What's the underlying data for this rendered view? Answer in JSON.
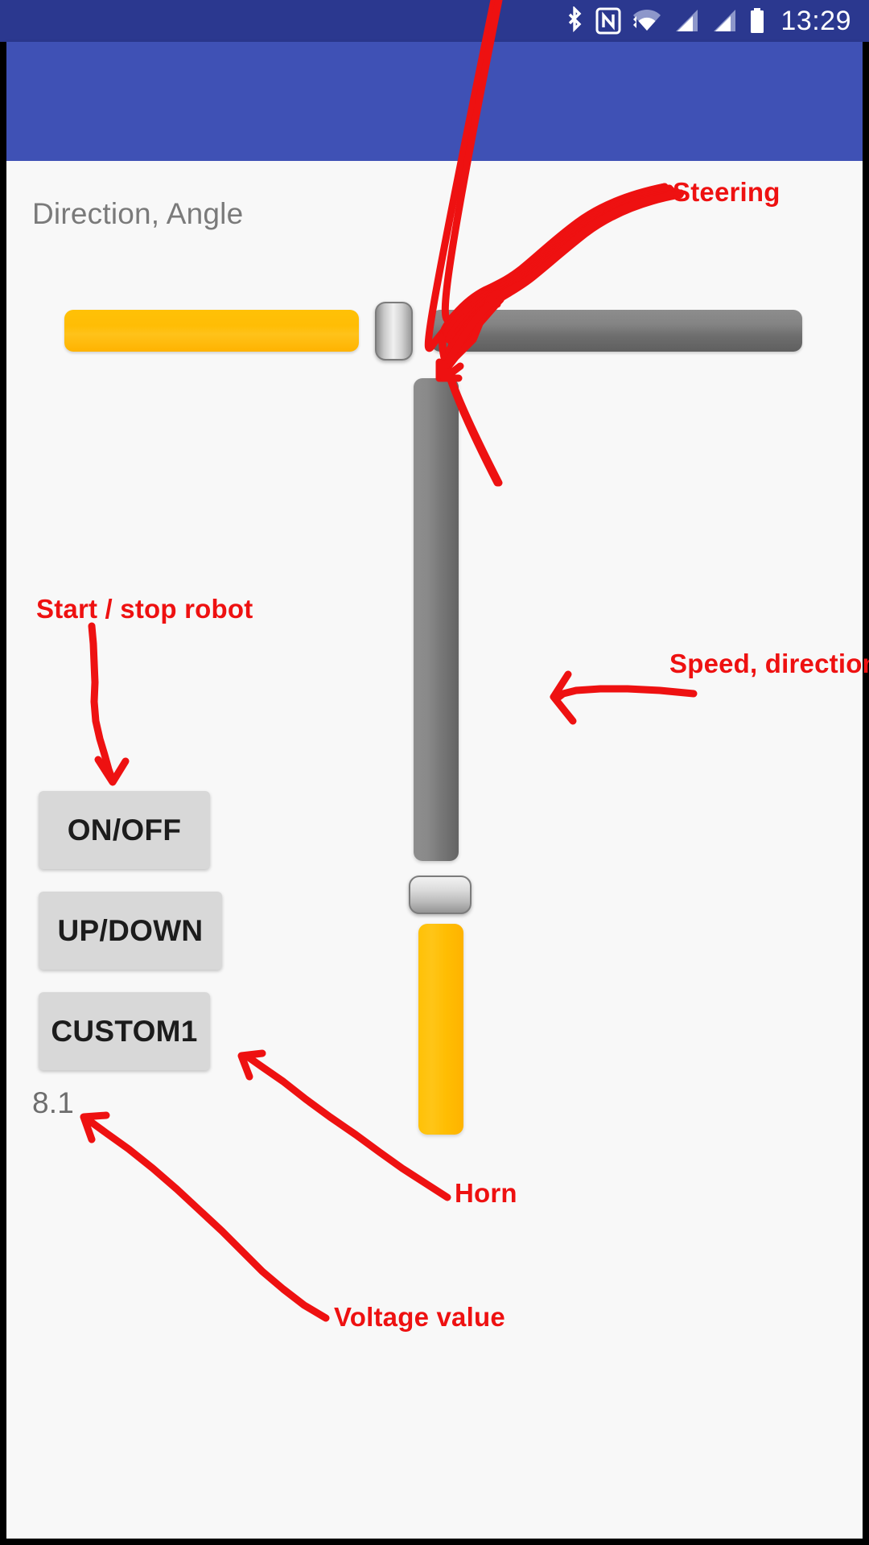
{
  "status_bar": {
    "clock": "13:29",
    "background_color": "#2b388f",
    "icons": [
      {
        "name": "bluetooth-icon",
        "label": "Bluetooth"
      },
      {
        "name": "nfc-icon",
        "label": "NFC"
      },
      {
        "name": "wifi-icon",
        "label": "Wi-Fi"
      },
      {
        "name": "signal-sim1-icon",
        "label": "Cellular signal SIM 1"
      },
      {
        "name": "signal-sim2-icon",
        "label": "Cellular signal SIM 2"
      },
      {
        "name": "battery-icon",
        "label": "Battery"
      }
    ]
  },
  "app_bar": {
    "title": "",
    "background_color": "#3f51b5"
  },
  "main": {
    "background_color": "#f8f8f8",
    "section_label": "Direction, Angle",
    "steering_slider": {
      "name": "steering-slider",
      "orientation": "horizontal",
      "fill_color": "#ffc107",
      "track_color": "#7a7a7a",
      "fill_percent": 40
    },
    "speed_slider": {
      "name": "speed-direction-slider",
      "orientation": "vertical",
      "fill_color": "#ffc107",
      "track_color": "#7a7a7a",
      "fill_percent": 28
    },
    "buttons": [
      {
        "name": "on-off-button",
        "label": "ON/OFF"
      },
      {
        "name": "up-down-button",
        "label": "UP/DOWN"
      },
      {
        "name": "custom1-button",
        "label": "CUSTOM1"
      }
    ],
    "voltage_value": "8.1"
  },
  "annotations": {
    "color": "#ee1111",
    "items": [
      {
        "name": "annotation-steering",
        "label": "Steering"
      },
      {
        "name": "annotation-start-stop-robot",
        "label": "Start / stop robot"
      },
      {
        "name": "annotation-speed-direction",
        "label": "Speed, direction"
      },
      {
        "name": "annotation-horn",
        "label": "Horn"
      },
      {
        "name": "annotation-voltage-value",
        "label": "Voltage value"
      }
    ]
  }
}
